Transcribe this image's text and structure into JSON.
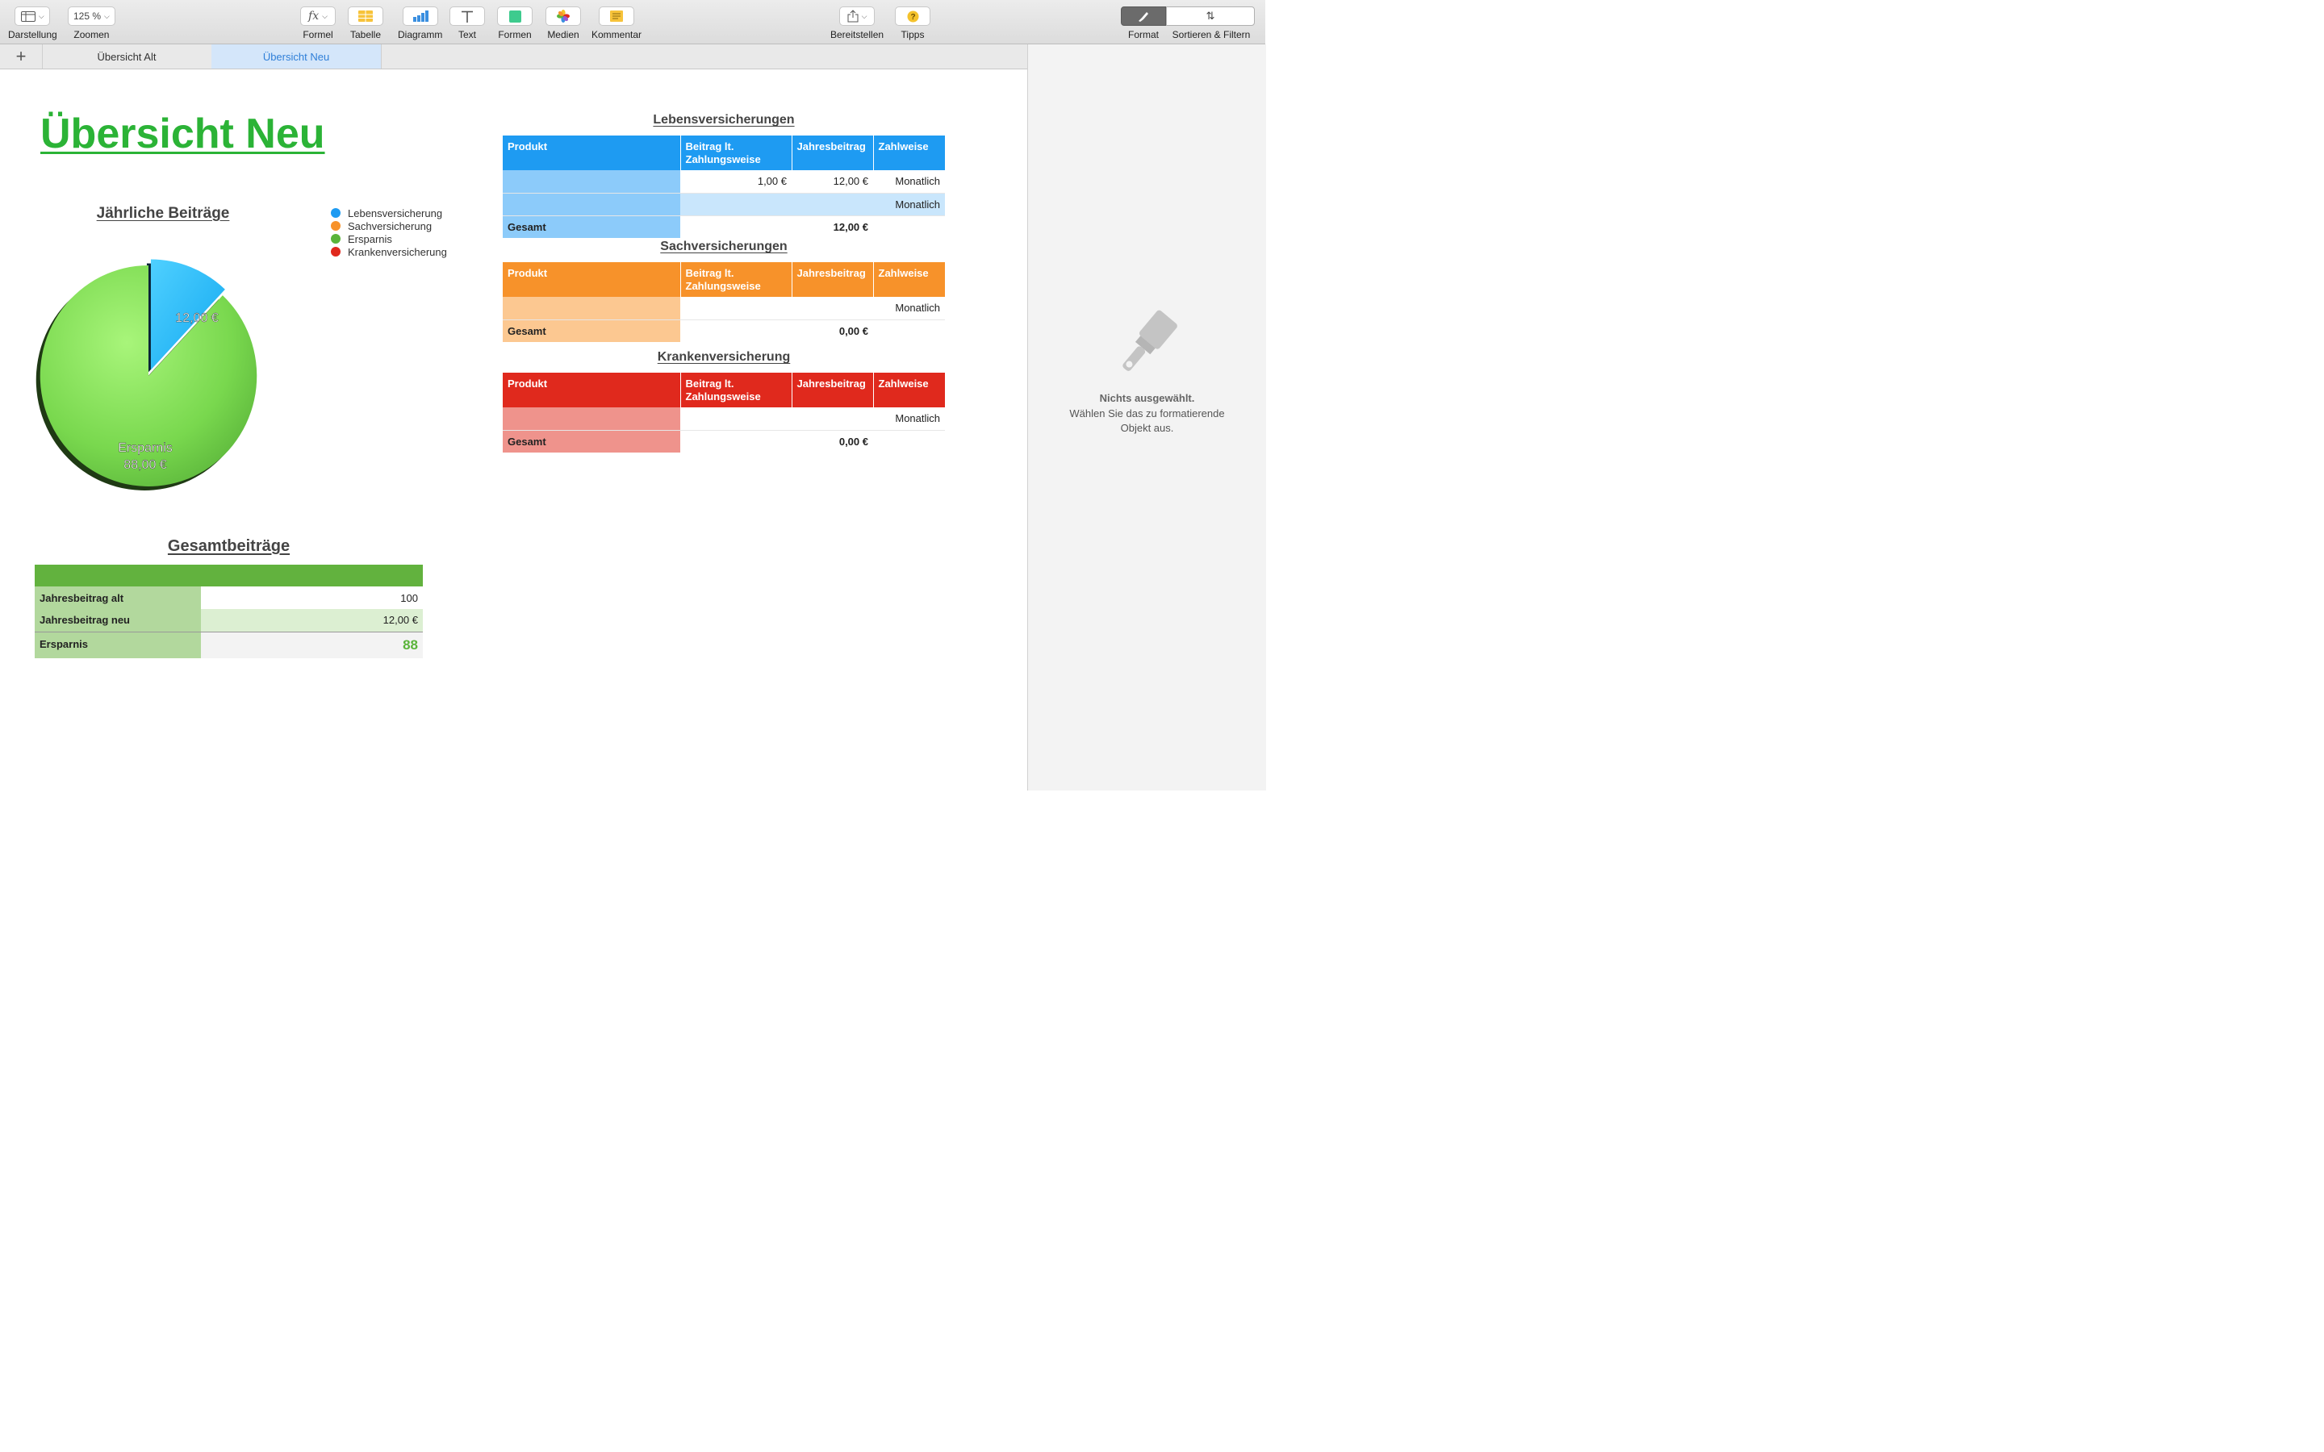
{
  "toolbar": {
    "left": [
      {
        "label": "Darstellung"
      },
      {
        "label": "Zoomen",
        "value": "125 %"
      }
    ],
    "center": [
      {
        "label": "Formel",
        "icon": "fx-icon"
      },
      {
        "label": "Tabelle",
        "icon": "table-icon"
      },
      {
        "label": "Diagramm",
        "icon": "chart-icon"
      },
      {
        "label": "Text",
        "icon": "text-icon"
      },
      {
        "label": "Formen",
        "icon": "shape-icon"
      },
      {
        "label": "Medien",
        "icon": "media-icon"
      },
      {
        "label": "Kommentar",
        "icon": "comment-icon"
      }
    ],
    "share": {
      "label": "Bereitstellen"
    },
    "tips": {
      "label": "Tipps"
    },
    "format": {
      "label": "Format"
    },
    "sort": {
      "label": "Sortieren & Filtern"
    }
  },
  "tabs": [
    {
      "label": "Übersicht Alt",
      "active": false
    },
    {
      "label": "Übersicht Neu",
      "active": true
    }
  ],
  "sheet": {
    "title": "Übersicht Neu",
    "pie": {
      "title": "Jährliche Beiträge",
      "legend": [
        "Lebensversicherung",
        "Sachversicherung",
        "Ersparnis",
        "Krankenversicherung"
      ],
      "slice_labels": {
        "leben": "12,00 €",
        "ersparnis_name": "Ersparnis",
        "ersparnis_value": "88,00 €"
      }
    },
    "gesamt": {
      "title": "Gesamtbeiträge",
      "rows": [
        {
          "label": "Jahresbeitrag alt",
          "value": "100"
        },
        {
          "label": "Jahresbeitrag neu",
          "value": "12,00 €"
        },
        {
          "label": "Ersparnis",
          "value": "88"
        }
      ]
    },
    "leben": {
      "title": "Lebensversicherungen",
      "headers": [
        "Produkt",
        "Beitrag lt. Zahlungsweise",
        "Jahresbeitrag",
        "Zahlweise"
      ],
      "rows": [
        [
          "",
          "1,00 €",
          "12,00 €",
          "Monatlich"
        ],
        [
          "",
          "",
          "",
          "Monatlich"
        ]
      ],
      "total_label": "Gesamt",
      "total_value": "12,00 €"
    },
    "sach": {
      "title": "Sachversicherungen",
      "headers": [
        "Produkt",
        "Beitrag lt. Zahlungsweise",
        "Jahresbeitrag",
        "Zahlweise"
      ],
      "rows": [
        [
          "",
          "",
          "",
          "Monatlich"
        ]
      ],
      "total_label": "Gesamt",
      "total_value": "0,00 €"
    },
    "kranken": {
      "title": "Krankenversicherung",
      "headers": [
        "Produkt",
        "Beitrag lt. Zahlungsweise",
        "Jahresbeitrag",
        "Zahlweise"
      ],
      "rows": [
        [
          "",
          "",
          "",
          "Monatlich"
        ]
      ],
      "total_label": "Gesamt",
      "total_value": "0,00 €"
    }
  },
  "inspector": {
    "line1": "Nichts ausgewählt.",
    "line2": "Wählen Sie das zu formatierende",
    "line3": "Objekt aus."
  },
  "colors": {
    "leben": "#1e9bf2",
    "sach": "#f7922a",
    "ersparnis": "#5ab43a",
    "kranken": "#e0291d",
    "title_green": "#2bb336"
  },
  "chart_data": {
    "type": "pie",
    "title": "Jährliche Beiträge",
    "categories": [
      "Lebensversicherung",
      "Sachversicherung",
      "Ersparnis",
      "Krankenversicherung"
    ],
    "values": [
      12,
      0,
      88,
      0
    ],
    "legend": "top-right",
    "colors": [
      "#1e9bf2",
      "#f7922a",
      "#5ab43a",
      "#e0291d"
    ]
  }
}
